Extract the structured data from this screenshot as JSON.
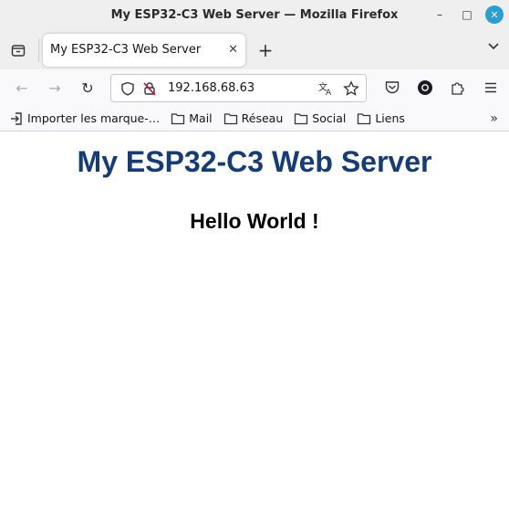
{
  "window": {
    "title": "My ESP32-C3 Web Server — Mozilla Firefox",
    "minimize_glyph": "–",
    "maximize_glyph": "□",
    "close_glyph": "✕"
  },
  "tabs": {
    "active": {
      "label": "My ESP32-C3 Web Server",
      "close_glyph": "✕"
    },
    "new_tab_glyph": "+",
    "list_all_glyph": "⌄"
  },
  "navbar": {
    "back_glyph": "←",
    "forward_glyph": "→",
    "reload_glyph": "↻",
    "url": "192.168.68.63"
  },
  "bookmarks": {
    "items": [
      {
        "label": "Importer les marque-…",
        "icon": "import-icon"
      },
      {
        "label": "Mail",
        "icon": "folder-icon"
      },
      {
        "label": "Réseau",
        "icon": "folder-icon"
      },
      {
        "label": "Social",
        "icon": "folder-icon"
      },
      {
        "label": "Liens",
        "icon": "folder-icon"
      }
    ],
    "overflow_glyph": "»"
  },
  "page": {
    "heading": "My ESP32-C3 Web Server",
    "subheading": "Hello World !"
  },
  "colors": {
    "heading": "#143c78",
    "close_button": "#2a9fd6",
    "toolbar_bg": "#f9f9fb",
    "titlebar_bg": "#efefef"
  }
}
